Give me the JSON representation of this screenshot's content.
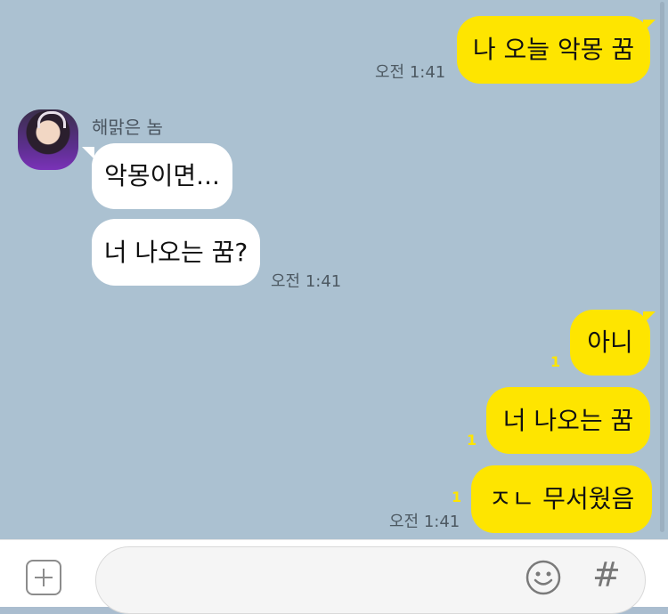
{
  "chat": {
    "messages": [
      {
        "text": "나 오늘 악몽 꿈",
        "time": "오전 1:41"
      },
      {
        "sender": "해맑은 놈"
      },
      {
        "text": "악몽이면..."
      },
      {
        "text": "너 나오는 꿈?",
        "time": "오전 1:41"
      },
      {
        "text": "아니",
        "unread": "1"
      },
      {
        "text": "너 나오는 꿈",
        "unread": "1"
      },
      {
        "text": "ㅈㄴ 무서웠음",
        "unread": "1",
        "time": "오전 1:41"
      }
    ]
  },
  "composer": {
    "input_value": ""
  },
  "icons": [
    "plus-icon",
    "emoji-icon",
    "hash-icon"
  ],
  "colors": {
    "background": "#abc1d1",
    "my_bubble": "#fee500",
    "their_bubble": "#ffffff"
  }
}
